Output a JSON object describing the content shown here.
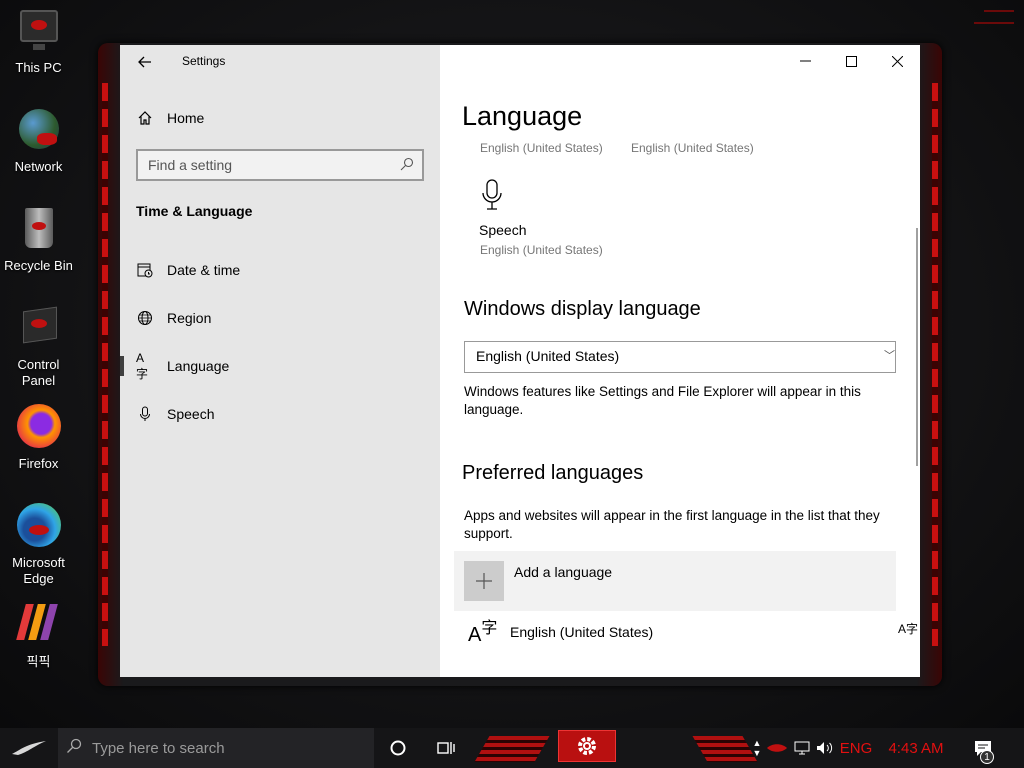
{
  "desktop": {
    "icons": [
      {
        "label": "This PC"
      },
      {
        "label": "Network"
      },
      {
        "label": "Recycle Bin"
      },
      {
        "label": "Control Panel"
      },
      {
        "label": "Firefox"
      },
      {
        "label": "Microsoft Edge"
      },
      {
        "label": "픽픽"
      }
    ]
  },
  "window": {
    "title": "Settings",
    "back_icon": "arrow-left-icon",
    "caption": {
      "minimize": "—",
      "maximize": "☐",
      "close": "✕"
    }
  },
  "sidebar": {
    "home_label": "Home",
    "search_placeholder": "Find a setting",
    "section_title": "Time & Language",
    "items": [
      {
        "label": "Date & time",
        "icon": "calendar-clock-icon"
      },
      {
        "label": "Region",
        "icon": "globe-icon"
      },
      {
        "label": "Language",
        "icon": "language-icon",
        "selected": true
      },
      {
        "label": "Speech",
        "icon": "microphone-icon"
      }
    ]
  },
  "main": {
    "page_title": "Language",
    "top_sub_left": "English (United States)",
    "top_sub_right": "English (United States)",
    "speech_tile": {
      "label": "Speech",
      "sub": "English (United States)"
    },
    "display_language": {
      "heading": "Windows display language",
      "selected": "English (United States)",
      "description": "Windows features like Settings and File Explorer will appear in this language."
    },
    "preferred": {
      "heading": "Preferred languages",
      "description": "Apps and websites will appear in the first language in the list that they support.",
      "add_label": "Add a language",
      "languages": [
        {
          "name": "English (United States)"
        }
      ]
    }
  },
  "taskbar": {
    "search_placeholder": "Type here to search",
    "tray_lang": "ENG",
    "clock": "4:43 AM",
    "notification_count": "1"
  },
  "colors": {
    "accent_red": "#e11010",
    "sidebar_bg": "#e6e6e6",
    "taskbar_bg": "#151517"
  }
}
